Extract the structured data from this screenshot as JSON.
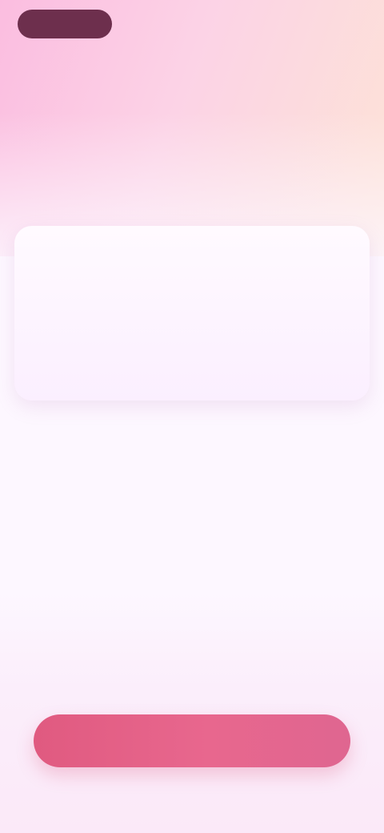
{
  "header": {
    "logo_label": "",
    "top_link": "",
    "secondary_link": ""
  },
  "hero": {
    "headline": "",
    "subtext": ""
  },
  "card": {
    "title": "",
    "accent": "",
    "body": "",
    "footnote": ""
  },
  "footer": {
    "title": "",
    "note": "",
    "cta_label": ""
  },
  "colors": {
    "accent": "#e05a80",
    "brand_dark": "#6d2f4d",
    "background": "#fdf7ff"
  }
}
